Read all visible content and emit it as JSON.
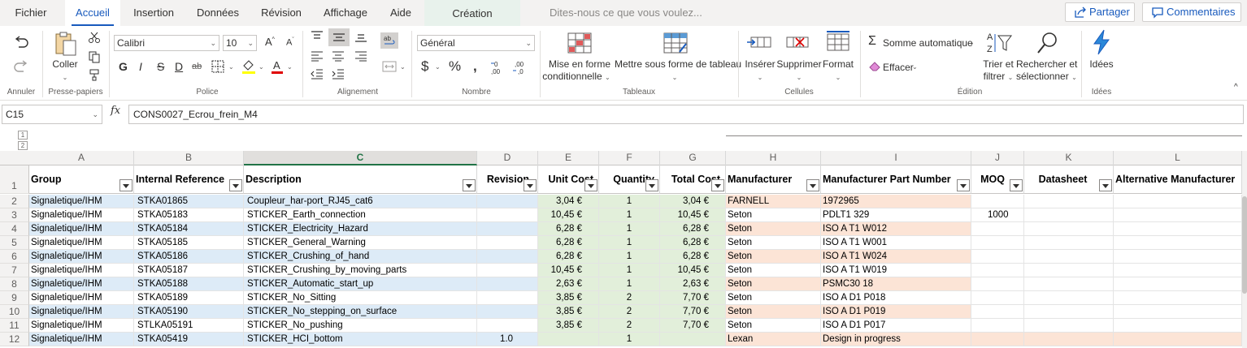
{
  "tabs": {
    "fichier": "Fichier",
    "accueil": "Accueil",
    "insertion": "Insertion",
    "donnees": "Données",
    "revision": "Révision",
    "affichage": "Affichage",
    "aide": "Aide",
    "creation": "Création"
  },
  "tell_me_placeholder": "Dites-nous ce que vous voulez...",
  "share_label": "Partager",
  "comments_label": "Commentaires",
  "ribbon": {
    "annuler_group": "Annuler",
    "presse_papiers": {
      "coller": "Coller",
      "group": "Presse-papiers"
    },
    "police": {
      "font": "Calibri",
      "size": "10",
      "group": "Police",
      "bold": "G",
      "italic": "I",
      "strike": "S",
      "underline": "D",
      "ab": "ab"
    },
    "alignement": {
      "group": "Alignement"
    },
    "nombre": {
      "format": "Général",
      "group": "Nombre"
    },
    "tableaux": {
      "mise_en_forme": "Mise en forme",
      "conditionnelle": "conditionnelle",
      "mettre_tableau": "Mettre sous forme de tableau",
      "group": "Tableaux"
    },
    "cellules": {
      "inserer": "Insérer",
      "supprimer": "Supprimer",
      "format": "Format",
      "group": "Cellules"
    },
    "edition": {
      "somme": "Somme automatique",
      "effacer": "Effacer",
      "trier": "Trier et",
      "filtrer": "filtrer",
      "rechercher": "Rechercher et",
      "selectionner": "sélectionner",
      "group": "Édition"
    },
    "idees": {
      "label": "Idées",
      "group": "Idées"
    }
  },
  "formula_bar": {
    "name_box": "C15",
    "fx": "fx",
    "content": "CONS0027_Ecrou_frein_M4"
  },
  "outline_levels": [
    "1",
    "2"
  ],
  "column_letters": [
    "A",
    "B",
    "C",
    "D",
    "E",
    "F",
    "G",
    "H",
    "I",
    "J",
    "K",
    "L"
  ],
  "selected_column": "C",
  "header_row": {
    "row_number": "1",
    "cells": [
      "Group",
      "Internal Reference",
      "Description",
      "Revision",
      "Unit Cost",
      "Quantity",
      "Total Cost",
      "Manufacturer",
      "Manufacturer Part Number",
      "MOQ",
      "Datasheet",
      "Alternative Manufacturer"
    ]
  },
  "colors": {
    "accent_blue": "#185abd",
    "excel_green": "#217346",
    "fill_blue": "#ddebf7",
    "fill_green": "#e2efda",
    "fill_salmon": "#fce4d6"
  },
  "rows": [
    {
      "n": "2",
      "group": "Signaletique/IHM",
      "ref": "STKA01865",
      "desc": "Coupleur_har-port_RJ45_cat6",
      "rev": "",
      "unit": "3,04 €",
      "qty": "1",
      "total": "3,04 €",
      "mfr": "FARNELL",
      "mpn": "1972965",
      "moq": ""
    },
    {
      "n": "3",
      "group": "Signaletique/IHM",
      "ref": "STKA05183",
      "desc": "STICKER_Earth_connection",
      "rev": "",
      "unit": "10,45 €",
      "qty": "1",
      "total": "10,45 €",
      "mfr": "Seton",
      "mpn": "PDLT1 329",
      "moq": "1000"
    },
    {
      "n": "4",
      "group": "Signaletique/IHM",
      "ref": "STKA05184",
      "desc": "STICKER_Electricity_Hazard",
      "rev": "",
      "unit": "6,28 €",
      "qty": "1",
      "total": "6,28 €",
      "mfr": "Seton",
      "mpn": "ISO A T1 W012",
      "moq": ""
    },
    {
      "n": "5",
      "group": "Signaletique/IHM",
      "ref": "STKA05185",
      "desc": "STICKER_General_Warning",
      "rev": "",
      "unit": "6,28 €",
      "qty": "1",
      "total": "6,28 €",
      "mfr": "Seton",
      "mpn": "ISO A T1 W001",
      "moq": ""
    },
    {
      "n": "6",
      "group": "Signaletique/IHM",
      "ref": "STKA05186",
      "desc": "STICKER_Crushing_of_hand",
      "rev": "",
      "unit": "6,28 €",
      "qty": "1",
      "total": "6,28 €",
      "mfr": "Seton",
      "mpn": "ISO A T1 W024",
      "moq": ""
    },
    {
      "n": "7",
      "group": "Signaletique/IHM",
      "ref": "STKA05187",
      "desc": "STICKER_Crushing_by_moving_parts",
      "rev": "",
      "unit": "10,45 €",
      "qty": "1",
      "total": "10,45 €",
      "mfr": "Seton",
      "mpn": "ISO A T1 W019",
      "moq": ""
    },
    {
      "n": "8",
      "group": "Signaletique/IHM",
      "ref": "STKA05188",
      "desc": "STICKER_Automatic_start_up",
      "rev": "",
      "unit": "2,63 €",
      "qty": "1",
      "total": "2,63 €",
      "mfr": "Seton",
      "mpn": "PSMC30 18",
      "moq": ""
    },
    {
      "n": "9",
      "group": "Signaletique/IHM",
      "ref": "STKA05189",
      "desc": "STICKER_No_Sitting",
      "rev": "",
      "unit": "3,85 €",
      "qty": "2",
      "total": "7,70 €",
      "mfr": "Seton",
      "mpn": "ISO A D1 P018",
      "moq": ""
    },
    {
      "n": "10",
      "group": "Signaletique/IHM",
      "ref": "STKA05190",
      "desc": "STICKER_No_stepping_on_surface",
      "rev": "",
      "unit": "3,85 €",
      "qty": "2",
      "total": "7,70 €",
      "mfr": "Seton",
      "mpn": "ISO A D1 P019",
      "moq": ""
    },
    {
      "n": "11",
      "group": "Signaletique/IHM",
      "ref": "STLKA05191",
      "desc": "STICKER_No_pushing",
      "rev": "",
      "unit": "3,85 €",
      "qty": "2",
      "total": "7,70 €",
      "mfr": "Seton",
      "mpn": "ISO A D1 P017",
      "moq": ""
    },
    {
      "n": "12",
      "group": "Signaletique/IHM",
      "ref": "STKA05419",
      "desc": "STICKER_HCI_bottom",
      "rev": "1.0",
      "unit": "",
      "qty": "1",
      "total": "",
      "mfr": "Lexan",
      "mpn": "Design in progress",
      "moq": ""
    }
  ]
}
